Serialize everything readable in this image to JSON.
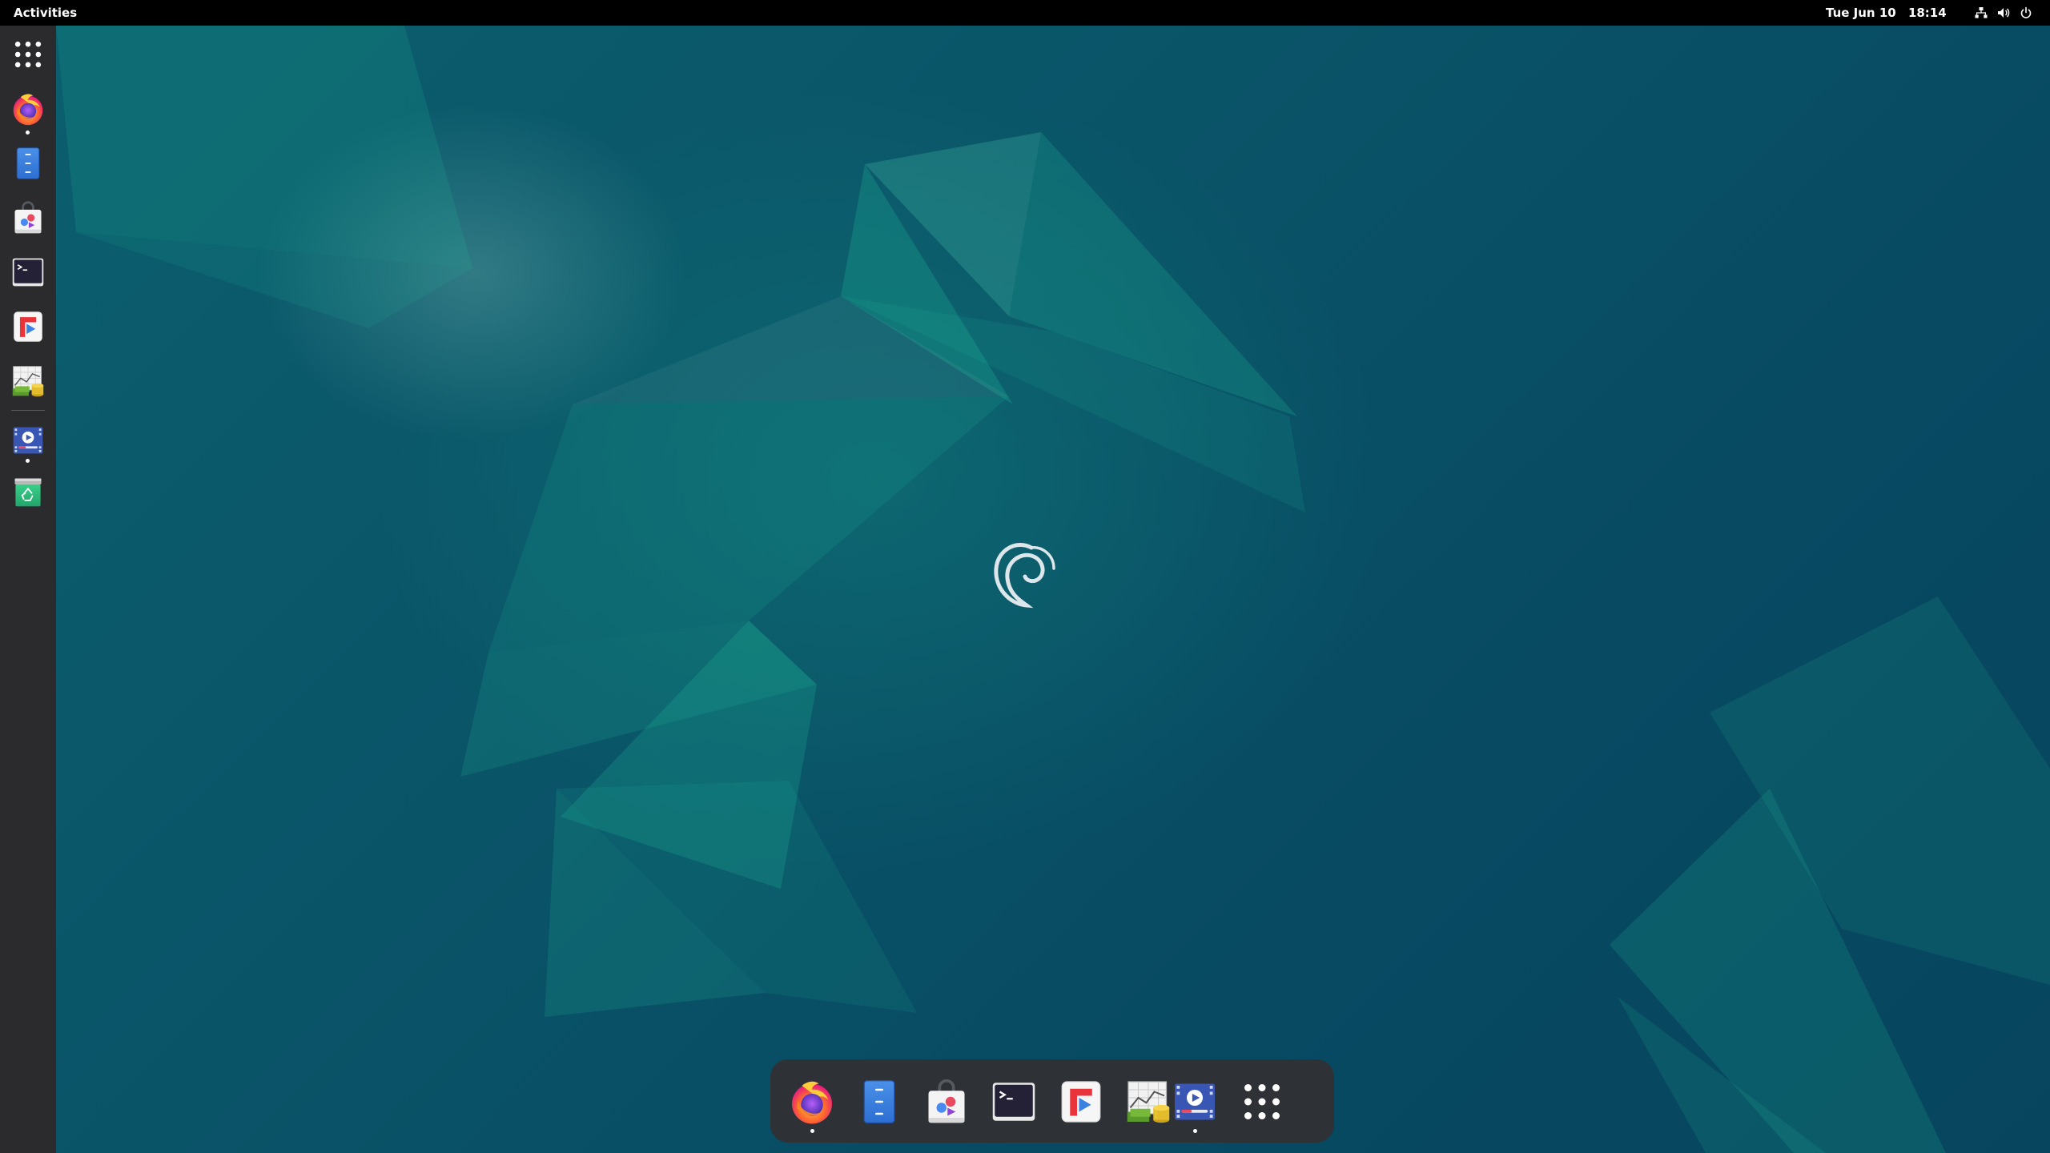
{
  "topbar": {
    "activities_label": "Activities",
    "clock_date": "Tue Jun 10",
    "clock_time": "18:14",
    "tray_icons": [
      "network-icon",
      "volume-icon",
      "power-icon"
    ]
  },
  "desktop": {
    "wallpaper": "debian-12-bookworm",
    "logo": "debian-swirl-icon",
    "colors": {
      "bar": "#000000",
      "dash": "#2b2b2d",
      "dock": "#2e3236",
      "wallpaper_primary": "#0a5468",
      "wallpaper_accent": "#12a58a"
    }
  },
  "left_dash": {
    "items": [
      {
        "name": "show-apps",
        "icon": "app-grid-icon",
        "running": false
      },
      {
        "name": "firefox",
        "icon": "firefox-icon",
        "running": true
      },
      {
        "name": "text-editor",
        "icon": "text-editor-icon",
        "running": false
      },
      {
        "name": "software",
        "icon": "software-icon",
        "running": false
      },
      {
        "name": "terminal",
        "icon": "terminal-icon",
        "running": false
      },
      {
        "name": "flathub",
        "icon": "flathub-icon",
        "running": false
      },
      {
        "name": "finance",
        "icon": "finance-icon",
        "running": false
      },
      {
        "name": "video-player",
        "icon": "video-player-icon",
        "running": true
      },
      {
        "name": "trash",
        "icon": "trash-icon",
        "running": false
      }
    ]
  },
  "dock": {
    "items": [
      {
        "name": "firefox",
        "icon": "firefox-icon",
        "running": true
      },
      {
        "name": "text-editor",
        "icon": "text-editor-icon",
        "running": false
      },
      {
        "name": "software",
        "icon": "software-icon",
        "running": false
      },
      {
        "name": "terminal",
        "icon": "terminal-icon",
        "running": false
      },
      {
        "name": "flathub",
        "icon": "flathub-icon",
        "running": false
      },
      {
        "name": "finance",
        "icon": "finance-icon",
        "running": false
      },
      {
        "name": "video-player",
        "icon": "video-player-icon",
        "running": true
      },
      {
        "name": "show-apps",
        "icon": "app-grid-icon",
        "running": false
      }
    ]
  }
}
